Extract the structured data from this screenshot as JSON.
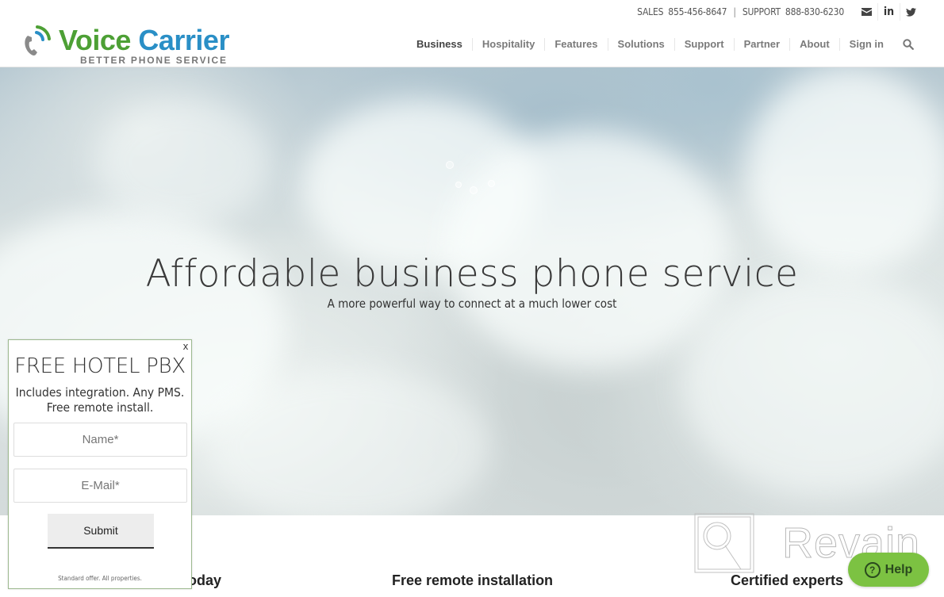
{
  "topbar": {
    "sales_label": "SALES",
    "sales_phone": "855-456-8647",
    "separator": "|",
    "support_label": "SUPPORT",
    "support_phone": "888-830-6230",
    "social": [
      {
        "name": "email-icon"
      },
      {
        "name": "linkedin-icon",
        "glyph": "in"
      },
      {
        "name": "twitter-icon"
      }
    ]
  },
  "logo": {
    "brand_part1": "Voice",
    "brand_part2": "Carrier",
    "tagline": "BETTER PHONE SERVICE",
    "colors": {
      "green": "#4da035",
      "blue": "#2a8fc6",
      "gray": "#777777"
    }
  },
  "nav": {
    "items": [
      {
        "label": "Business",
        "active": true
      },
      {
        "label": "Hospitality"
      },
      {
        "label": "Features"
      },
      {
        "label": "Solutions"
      },
      {
        "label": "Support"
      },
      {
        "label": "Partner"
      },
      {
        "label": "About"
      },
      {
        "label": "Sign in"
      }
    ],
    "search_icon": "search-icon"
  },
  "hero": {
    "title": "Affordable business phone service",
    "subtitle": "A more powerful way to connect at a much lower cost"
  },
  "popup": {
    "close_label": "x",
    "title": "FREE HOTEL PBX",
    "subtitle_line1": "Includes integration. Any PMS.",
    "subtitle_line2": "Free remote install.",
    "name_placeholder": "Name*",
    "email_placeholder": "E-Mail*",
    "submit_label": "Submit",
    "fine_print": "Standard offer. All properties.",
    "border_color": "#9db98f"
  },
  "features": [
    {
      "title": "today"
    },
    {
      "title": "Free remote installation"
    },
    {
      "title": "Certified experts"
    }
  ],
  "watermark": {
    "text": "Revain"
  },
  "help": {
    "label": "Help",
    "icon": "?",
    "color": "#7cc242"
  }
}
